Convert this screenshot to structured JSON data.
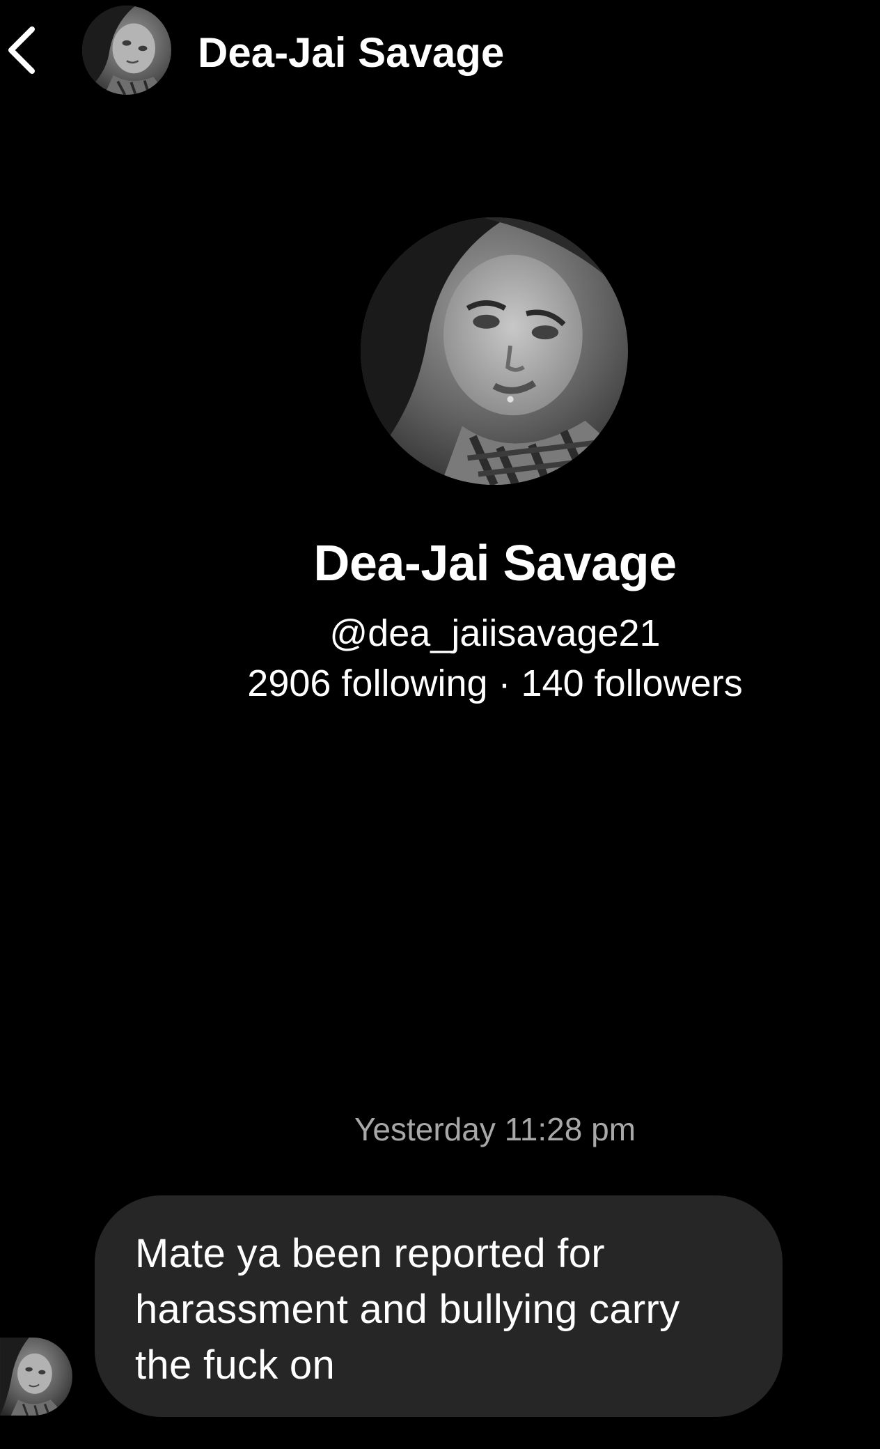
{
  "header": {
    "back_icon": "chevron-left-icon",
    "avatar": "profile-photo",
    "title": "Dea-Jai Savage"
  },
  "profile": {
    "avatar": "profile-photo",
    "name": "Dea-Jai Savage",
    "handle": "@dea_jaiisavage21",
    "stats": "2906 following · 140 followers"
  },
  "conversation": {
    "timestamp": "Yesterday 11:28 pm",
    "messages": [
      {
        "sender": "Dea-Jai Savage",
        "text": "Mate ya been reported for harassment and bullying carry the fuck on"
      }
    ]
  },
  "colors": {
    "background": "#000000",
    "bubble": "#262626",
    "timestamp_text": "#a8a8a8",
    "text": "#ffffff"
  }
}
